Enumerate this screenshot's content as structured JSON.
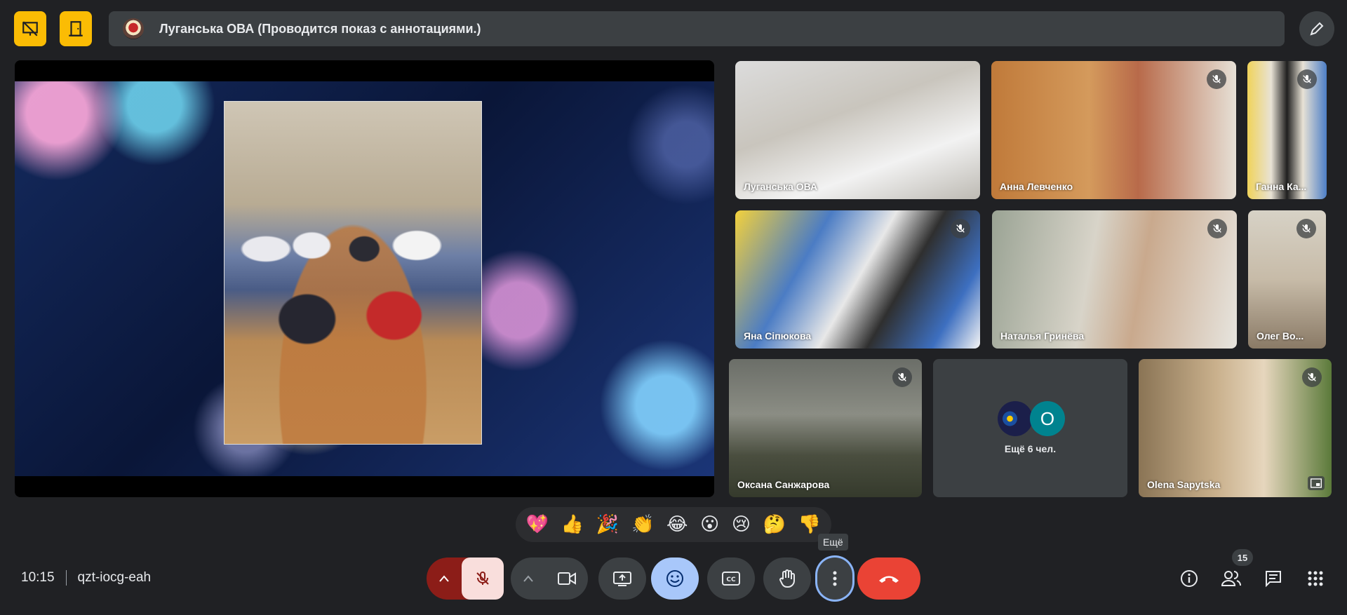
{
  "meeting": {
    "title": "Луганська ОВА (Проводится показ с аннотациями.)",
    "time": "10:15",
    "code": "qzt-iocg-eah",
    "participant_count": "15"
  },
  "tiles": [
    {
      "name": "Луганська ОВА",
      "muted": false
    },
    {
      "name": "Анна Левченко",
      "muted": true
    },
    {
      "name": "Ганна Ка...",
      "muted": true
    },
    {
      "name": "Яна Сіпюкова",
      "muted": true
    },
    {
      "name": "Наталья Гринёва",
      "muted": true
    },
    {
      "name": "Олег Во...",
      "muted": true
    },
    {
      "name": "Оксана Санжарова",
      "muted": true
    },
    {
      "name": "Olena Sapytska",
      "muted": true
    }
  ],
  "more_tile": {
    "label": "Ещё 6 чел.",
    "avatar_letter": "O"
  },
  "reactions": [
    "💖",
    "👍",
    "🎉",
    "👏",
    "😂",
    "😮",
    "😢",
    "🤔",
    "👎"
  ],
  "tooltip": "Ещё",
  "colors": {
    "accent_yellow": "#fbbc04",
    "end_call_red": "#ea4335",
    "reaction_blue": "#a8c7fa",
    "mic_off_bg": "#f9dedc",
    "dark_red": "#8c1d18"
  }
}
